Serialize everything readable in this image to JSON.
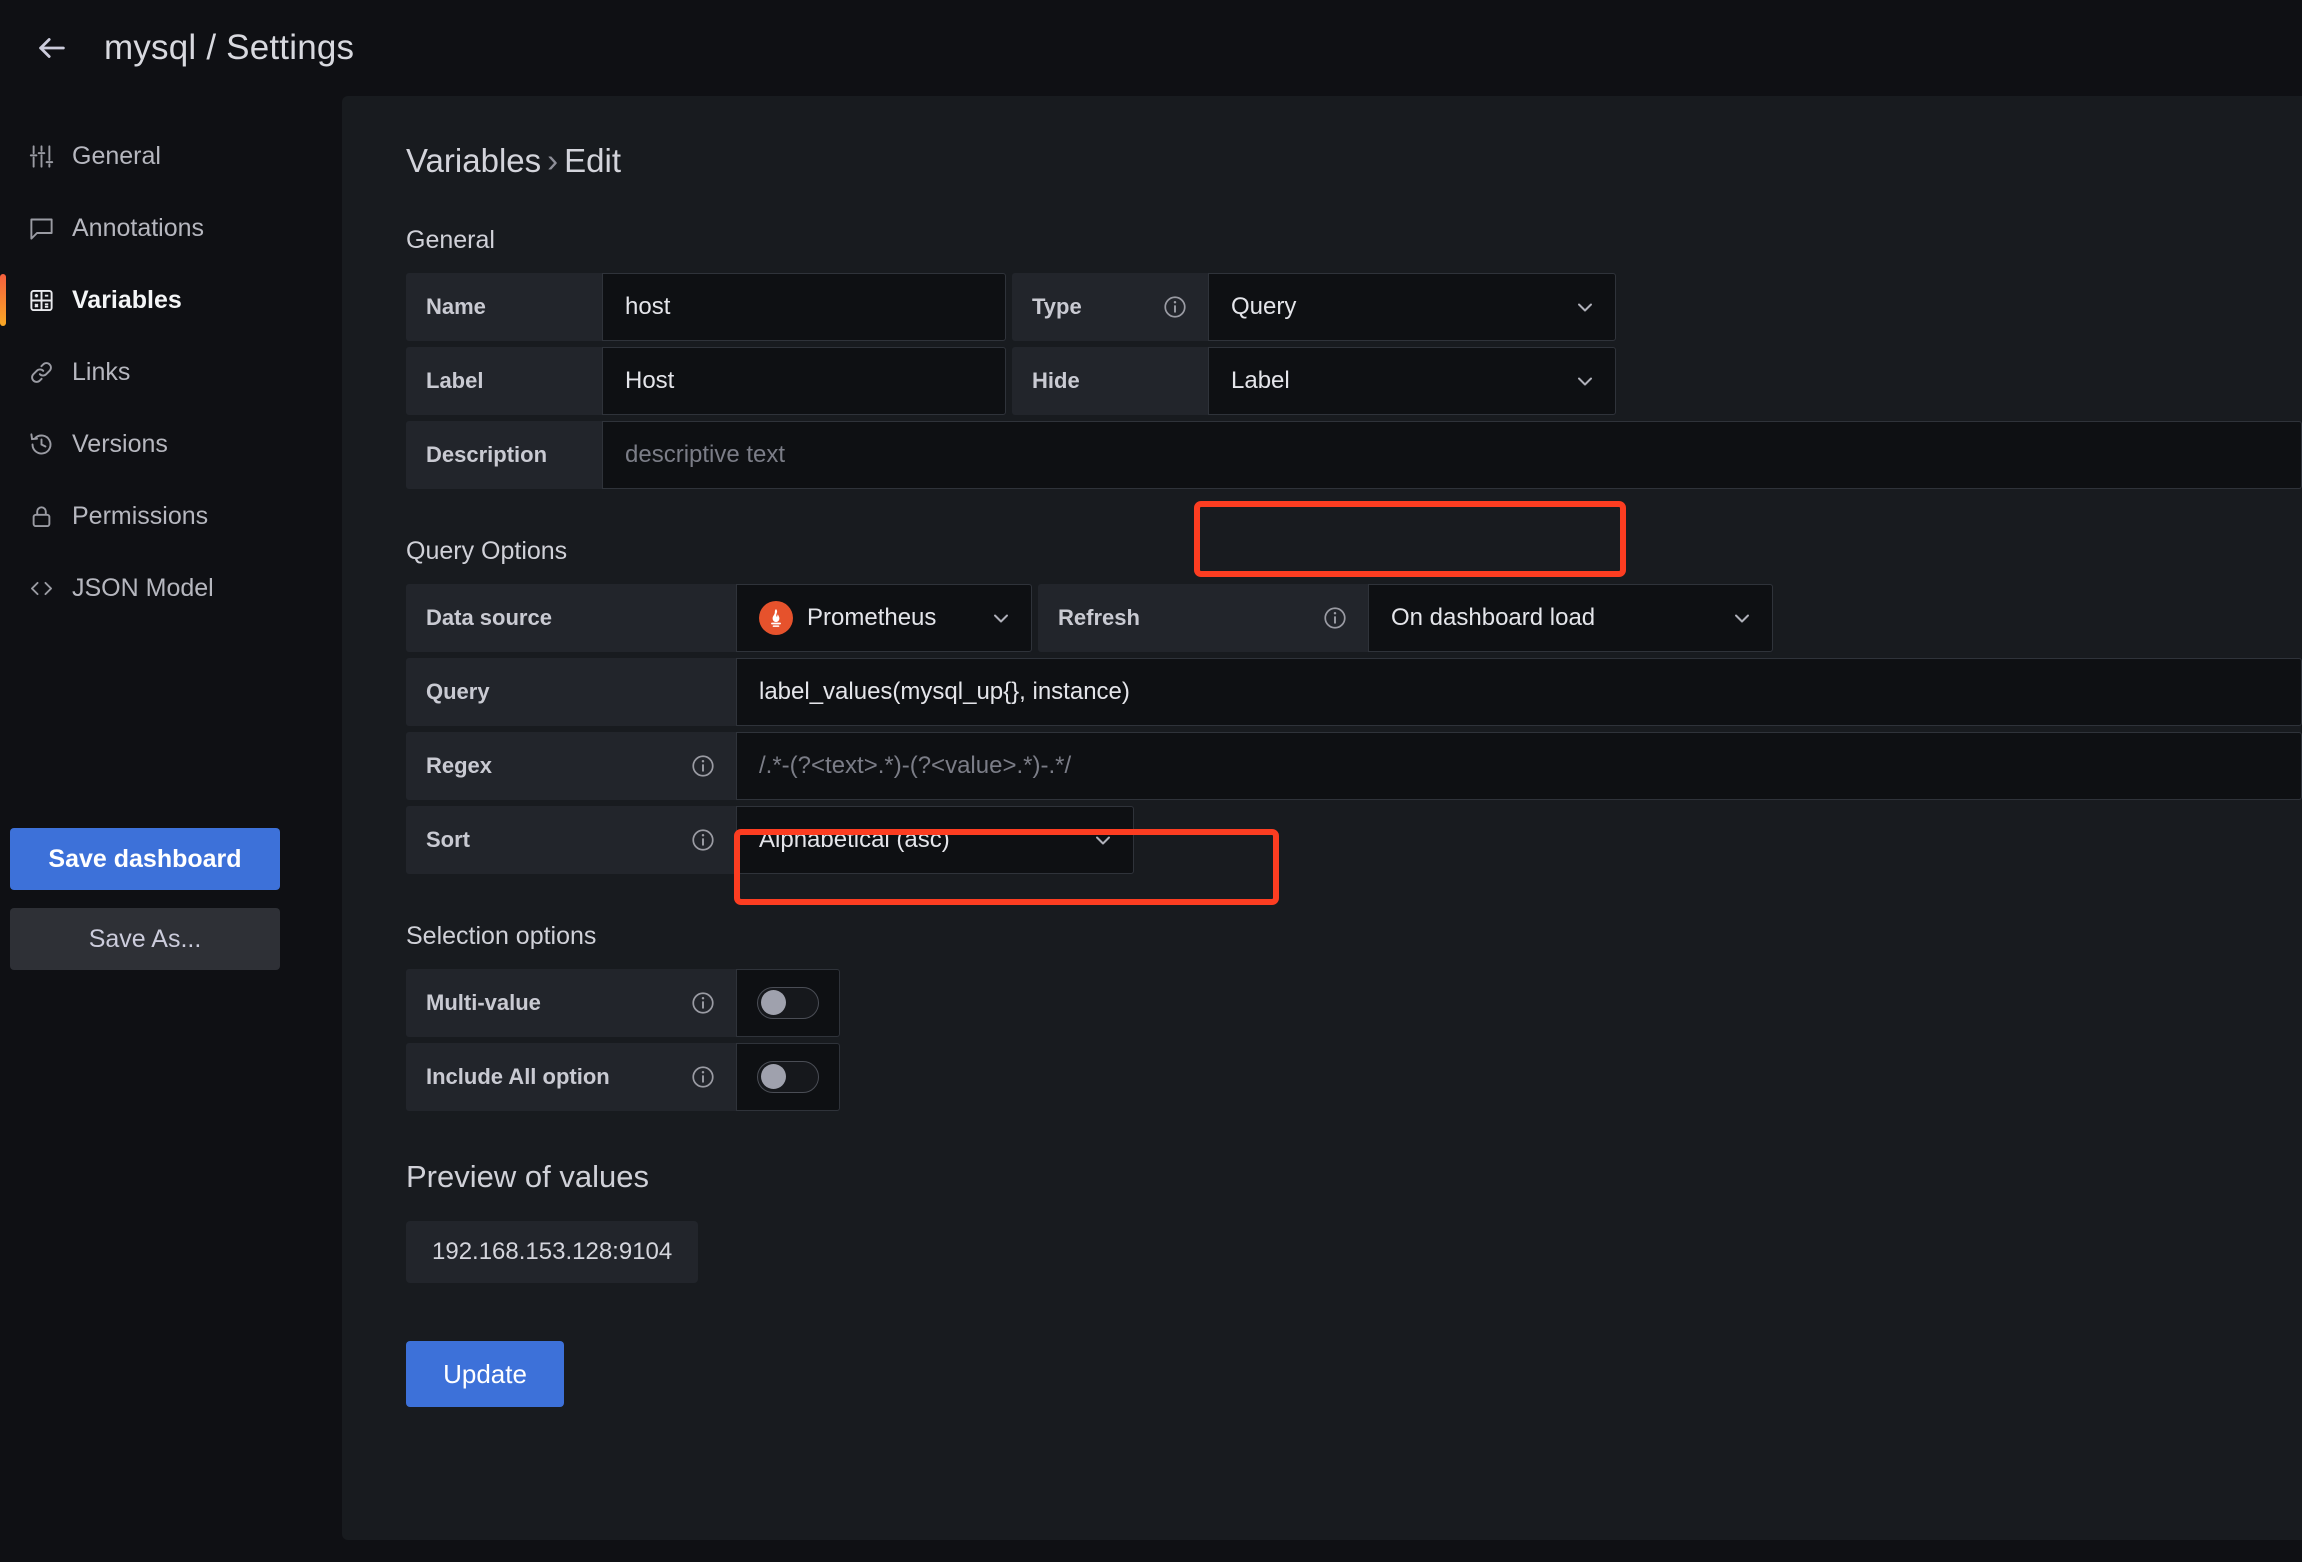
{
  "header": {
    "back_icon": "arrow-left-icon",
    "title": "mysql / Settings"
  },
  "sidebar": {
    "items": [
      {
        "label": "General",
        "icon": "sliders-icon",
        "active": false
      },
      {
        "label": "Annotations",
        "icon": "comment-icon",
        "active": false
      },
      {
        "label": "Variables",
        "icon": "table-grid-icon",
        "active": true
      },
      {
        "label": "Links",
        "icon": "link-icon",
        "active": false
      },
      {
        "label": "Versions",
        "icon": "history-icon",
        "active": false
      },
      {
        "label": "Permissions",
        "icon": "lock-icon",
        "active": false
      },
      {
        "label": "JSON Model",
        "icon": "code-icon",
        "active": false
      }
    ],
    "save_dashboard_label": "Save dashboard",
    "save_as_label": "Save As..."
  },
  "main": {
    "breadcrumb": {
      "parent": "Variables",
      "separator": "›",
      "current": "Edit"
    },
    "general": {
      "heading": "General",
      "name": {
        "label": "Name",
        "value": "host"
      },
      "type": {
        "label": "Type",
        "value": "Query",
        "info": "info-icon"
      },
      "label_field": {
        "label": "Label",
        "value": "Host"
      },
      "hide": {
        "label": "Hide",
        "value": "Label"
      },
      "description": {
        "label": "Description",
        "placeholder": "descriptive text"
      }
    },
    "query_options": {
      "heading": "Query Options",
      "data_source": {
        "label": "Data source",
        "value": "Prometheus",
        "icon": "prometheus-icon"
      },
      "refresh": {
        "label": "Refresh",
        "value": "On dashboard load",
        "info": "info-icon"
      },
      "query": {
        "label": "Query",
        "value": "label_values(mysql_up{}, instance)"
      },
      "regex": {
        "label": "Regex",
        "placeholder": "/.*-(?<text>.*)-(?<value>.*)-.*/",
        "info": "info-icon"
      },
      "sort": {
        "label": "Sort",
        "value": "Alphabetical (asc)",
        "info": "info-icon"
      }
    },
    "selection_options": {
      "heading": "Selection options",
      "multi_value": {
        "label": "Multi-value",
        "state": "off",
        "info": "info-icon"
      },
      "include_all": {
        "label": "Include All option",
        "state": "off",
        "info": "info-icon"
      }
    },
    "preview": {
      "heading": "Preview of values",
      "values": [
        "192.168.153.128:9104"
      ]
    },
    "update_label": "Update"
  },
  "annotations": {
    "highlight_color": "#fc3d21",
    "highlighted_fields": [
      "hide-select",
      "query-input"
    ]
  },
  "colors": {
    "accent_blue": "#3d71d9",
    "active_gradient_start": "#f55f3e",
    "active_gradient_end": "#f9a825",
    "prometheus_orange": "#e6522c",
    "panel_bg": "#181b1f",
    "page_bg": "#0f1014"
  }
}
